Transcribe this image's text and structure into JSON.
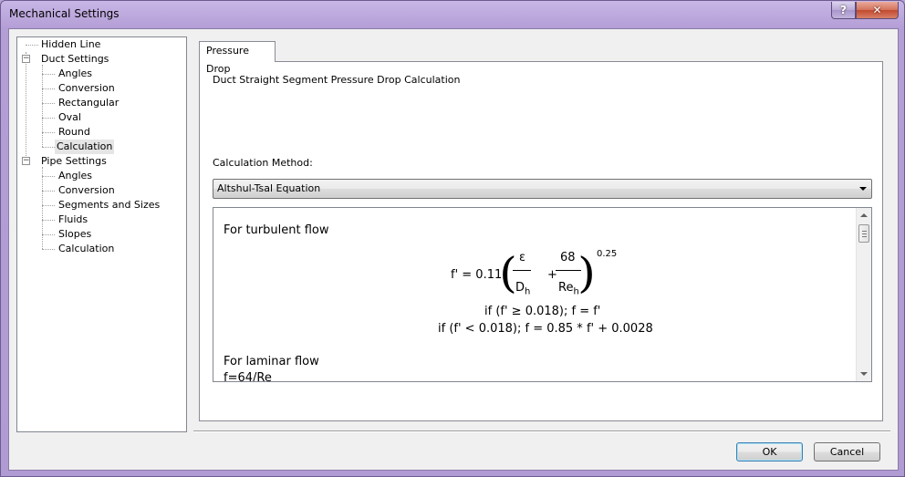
{
  "window": {
    "title": "Mechanical Settings",
    "help_label": "?",
    "close_label": "✕"
  },
  "tree": {
    "items": [
      {
        "label": "Hidden Line",
        "level": 0
      },
      {
        "label": "Duct Settings",
        "level": 0,
        "expander": "−"
      },
      {
        "label": "Angles",
        "level": 1
      },
      {
        "label": "Conversion",
        "level": 1
      },
      {
        "label": "Rectangular",
        "level": 1
      },
      {
        "label": "Oval",
        "level": 1
      },
      {
        "label": "Round",
        "level": 1
      },
      {
        "label": "Calculation",
        "level": 1,
        "selected": true
      },
      {
        "label": "Pipe Settings",
        "level": 0,
        "expander": "−"
      },
      {
        "label": "Angles",
        "level": 1
      },
      {
        "label": "Conversion",
        "level": 1
      },
      {
        "label": "Segments and Sizes",
        "level": 1
      },
      {
        "label": "Fluids",
        "level": 1
      },
      {
        "label": "Slopes",
        "level": 1
      },
      {
        "label": "Calculation",
        "level": 1
      }
    ]
  },
  "tab": {
    "label": "Pressure Drop"
  },
  "panel": {
    "heading": "Duct Straight Segment Pressure Drop Calculation",
    "method_label": "Calculation Method:",
    "method_value": "Altshul-Tsal Equation"
  },
  "formula": {
    "turbulent_heading": "For turbulent flow",
    "lhs": "f' = 0.11",
    "num1": "ε",
    "den1_main": "D",
    "den1_sub": "h",
    "plus": "+",
    "num2": "68",
    "den2_main": "Re",
    "den2_sub": "h",
    "exponent": "0.25",
    "paren_open": "(",
    "paren_close": ")",
    "cond1": "if (f' ≥ 0.018); f = f'",
    "cond2": "if (f' < 0.018); f = 0.85 * f' + 0.0028",
    "laminar_heading": "For laminar flow",
    "laminar_formula": "f=64/Re"
  },
  "buttons": {
    "ok": "OK",
    "cancel": "Cancel"
  }
}
